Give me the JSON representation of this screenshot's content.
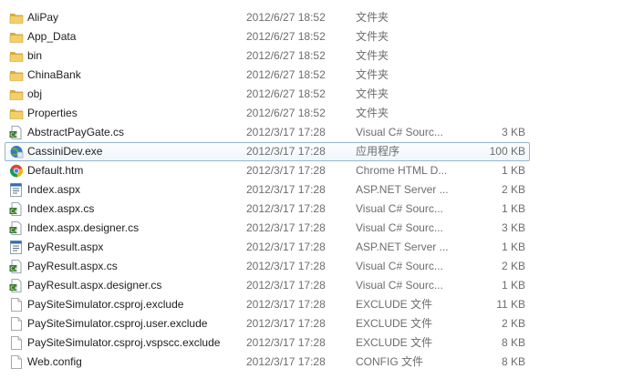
{
  "files": [
    {
      "name": "AliPay",
      "modified": "2012/6/27 18:52",
      "type": "文件夹",
      "size": "",
      "icon": "folder-icon"
    },
    {
      "name": "App_Data",
      "modified": "2012/6/27 18:52",
      "type": "文件夹",
      "size": "",
      "icon": "folder-icon"
    },
    {
      "name": "bin",
      "modified": "2012/6/27 18:52",
      "type": "文件夹",
      "size": "",
      "icon": "folder-icon"
    },
    {
      "name": "ChinaBank",
      "modified": "2012/6/27 18:52",
      "type": "文件夹",
      "size": "",
      "icon": "folder-icon"
    },
    {
      "name": "obj",
      "modified": "2012/6/27 18:52",
      "type": "文件夹",
      "size": "",
      "icon": "folder-icon"
    },
    {
      "name": "Properties",
      "modified": "2012/6/27 18:52",
      "type": "文件夹",
      "size": "",
      "icon": "folder-icon"
    },
    {
      "name": "AbstractPayGate.cs",
      "modified": "2012/3/17 17:28",
      "type": "Visual C# Sourc...",
      "size": "3 KB",
      "icon": "csharp-file-icon"
    },
    {
      "name": "CassiniDev.exe",
      "modified": "2012/3/17 17:28",
      "type": "应用程序",
      "size": "100 KB",
      "icon": "exe-globe-icon",
      "selected": true
    },
    {
      "name": "Default.htm",
      "modified": "2012/3/17 17:28",
      "type": "Chrome HTML D...",
      "size": "1 KB",
      "icon": "chrome-icon"
    },
    {
      "name": "Index.aspx",
      "modified": "2012/3/17 17:28",
      "type": "ASP.NET Server ...",
      "size": "2 KB",
      "icon": "aspx-file-icon"
    },
    {
      "name": "Index.aspx.cs",
      "modified": "2012/3/17 17:28",
      "type": "Visual C# Sourc...",
      "size": "1 KB",
      "icon": "csharp-file-icon"
    },
    {
      "name": "Index.aspx.designer.cs",
      "modified": "2012/3/17 17:28",
      "type": "Visual C# Sourc...",
      "size": "3 KB",
      "icon": "csharp-file-icon"
    },
    {
      "name": "PayResult.aspx",
      "modified": "2012/3/17 17:28",
      "type": "ASP.NET Server ...",
      "size": "1 KB",
      "icon": "aspx-file-icon"
    },
    {
      "name": "PayResult.aspx.cs",
      "modified": "2012/3/17 17:28",
      "type": "Visual C# Sourc...",
      "size": "2 KB",
      "icon": "csharp-file-icon"
    },
    {
      "name": "PayResult.aspx.designer.cs",
      "modified": "2012/3/17 17:28",
      "type": "Visual C# Sourc...",
      "size": "1 KB",
      "icon": "csharp-file-icon"
    },
    {
      "name": "PaySiteSimulator.csproj.exclude",
      "modified": "2012/3/17 17:28",
      "type": "EXCLUDE 文件",
      "size": "11 KB",
      "icon": "blank-file-icon"
    },
    {
      "name": "PaySiteSimulator.csproj.user.exclude",
      "modified": "2012/3/17 17:28",
      "type": "EXCLUDE 文件",
      "size": "2 KB",
      "icon": "blank-file-icon"
    },
    {
      "name": "PaySiteSimulator.csproj.vspscc.exclude",
      "modified": "2012/3/17 17:28",
      "type": "EXCLUDE 文件",
      "size": "8 KB",
      "icon": "blank-file-icon"
    },
    {
      "name": "Web.config",
      "modified": "2012/3/17 17:28",
      "type": "CONFIG 文件",
      "size": "8 KB",
      "icon": "blank-file-icon"
    }
  ],
  "colors": {
    "folder": "#e8c25a",
    "selection_border": "#99b4d1",
    "secondary_text": "#6d6d6d"
  }
}
